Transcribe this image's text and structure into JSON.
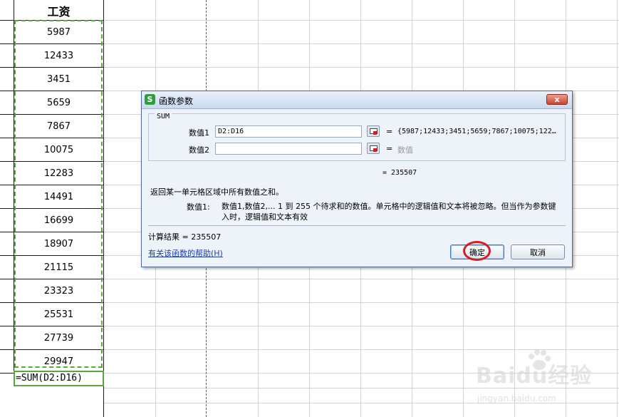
{
  "sheet": {
    "header": "工资",
    "values": [
      "5987",
      "12433",
      "3451",
      "5659",
      "7867",
      "10075",
      "12283",
      "14491",
      "16699",
      "18907",
      "21115",
      "23323",
      "25531",
      "27739",
      "29947"
    ],
    "formula": "=SUM(D2:D16)"
  },
  "dialog": {
    "title": "函数参数",
    "function_name": "SUM",
    "arg1_label": "数值1",
    "arg1_value": "D2:D16",
    "arg1_result": "{5987;12433;3451;5659;7867;10075;122…",
    "arg2_label": "数值2",
    "arg2_value": "",
    "arg2_placeholder": "数值",
    "equals": "=",
    "function_result": "= 235507",
    "description": "返回某一单元格区域中所有数值之和。",
    "arg_desc_label": "数值1:",
    "arg_desc": "数值1,数值2,... 1 到 255 个待求和的数值。单元格中的逻辑值和文本将被忽略。但当作为参数键入时，逻辑值和文本有效",
    "calc_result": "计算结果 = 235507",
    "help_link": "有关该函数的帮助(H)",
    "ok_label": "确定",
    "cancel_label": "取消",
    "close_label": "x",
    "app_icon_label": "S",
    "icons": [
      "spreadsheet-app-icon",
      "close-icon",
      "range-select-icon"
    ]
  },
  "watermark": {
    "logo": "Baidu经验",
    "url": "jingyan.baidu.com"
  },
  "colors": {
    "selection_dash": "#5aa63c",
    "highlight_ring": "#d31f1f",
    "dialog_bg": "#eef3fa",
    "link": "#1a3ea8"
  }
}
